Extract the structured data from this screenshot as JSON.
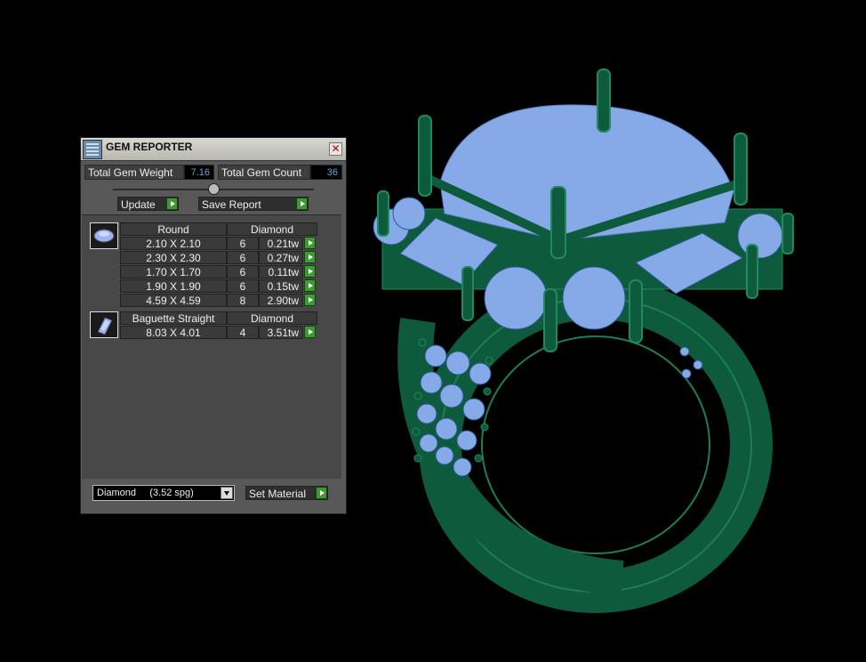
{
  "window": {
    "title": "GEM REPORTER",
    "close_glyph": "✕"
  },
  "totals": {
    "weight_label": "Total Gem Weight",
    "weight_value": "7.16",
    "count_label": "Total Gem Count",
    "count_value": "36"
  },
  "buttons": {
    "update": "Update",
    "save_report": "Save Report",
    "set_material": "Set Material"
  },
  "groups": [
    {
      "icon": "round-gem-icon",
      "shape": "Round",
      "material": "Diamond",
      "rows": [
        {
          "size": "2.10 X 2.10",
          "count": "6",
          "weight": "0.21tw"
        },
        {
          "size": "2.30 X 2.30",
          "count": "6",
          "weight": "0.27tw"
        },
        {
          "size": "1.70 X 1.70",
          "count": "6",
          "weight": "0.11tw"
        },
        {
          "size": "1.90 X 1.90",
          "count": "6",
          "weight": "0.15tw"
        },
        {
          "size": "4.59 X 4.59",
          "count": "8",
          "weight": "2.90tw"
        }
      ]
    },
    {
      "icon": "baguette-gem-icon",
      "shape": "Baguette Straight",
      "material": "Diamond",
      "rows": [
        {
          "size": "8.03 X 4.01",
          "count": "4",
          "weight": "3.51tw"
        }
      ]
    }
  ],
  "material_select": {
    "value": "Diamond     (3.52 spg)"
  },
  "colors": {
    "metal": "#0e5a3c",
    "metal_highlight": "#1f8a5e",
    "gem": "#86a9e8",
    "button_green": "#3c9c32"
  }
}
